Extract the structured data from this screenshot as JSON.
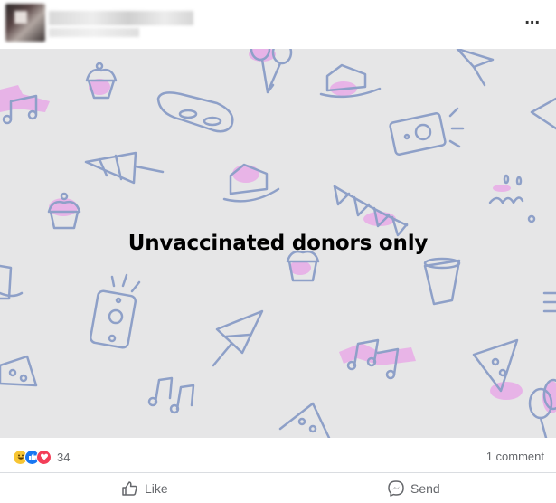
{
  "post": {
    "more_icon": "more-dots-icon",
    "more_label": "...",
    "headline": "Unvaccinated donors only",
    "reactions": {
      "icons": [
        "haha-reaction-icon",
        "like-reaction-icon",
        "love-reaction-icon"
      ],
      "count": "34"
    },
    "comments_label": "1 comment",
    "actions": {
      "like_label": "Like",
      "send_label": "Send"
    }
  },
  "colors": {
    "image_bg": "#e6e6e7",
    "doodle_stroke": "#8ea0c8",
    "doodle_highlight": "#e98ae8",
    "meta_text": "#65676b",
    "like_blue": "#1877f2",
    "love_red": "#f33e58",
    "haha_yellow": "#f7c533"
  }
}
